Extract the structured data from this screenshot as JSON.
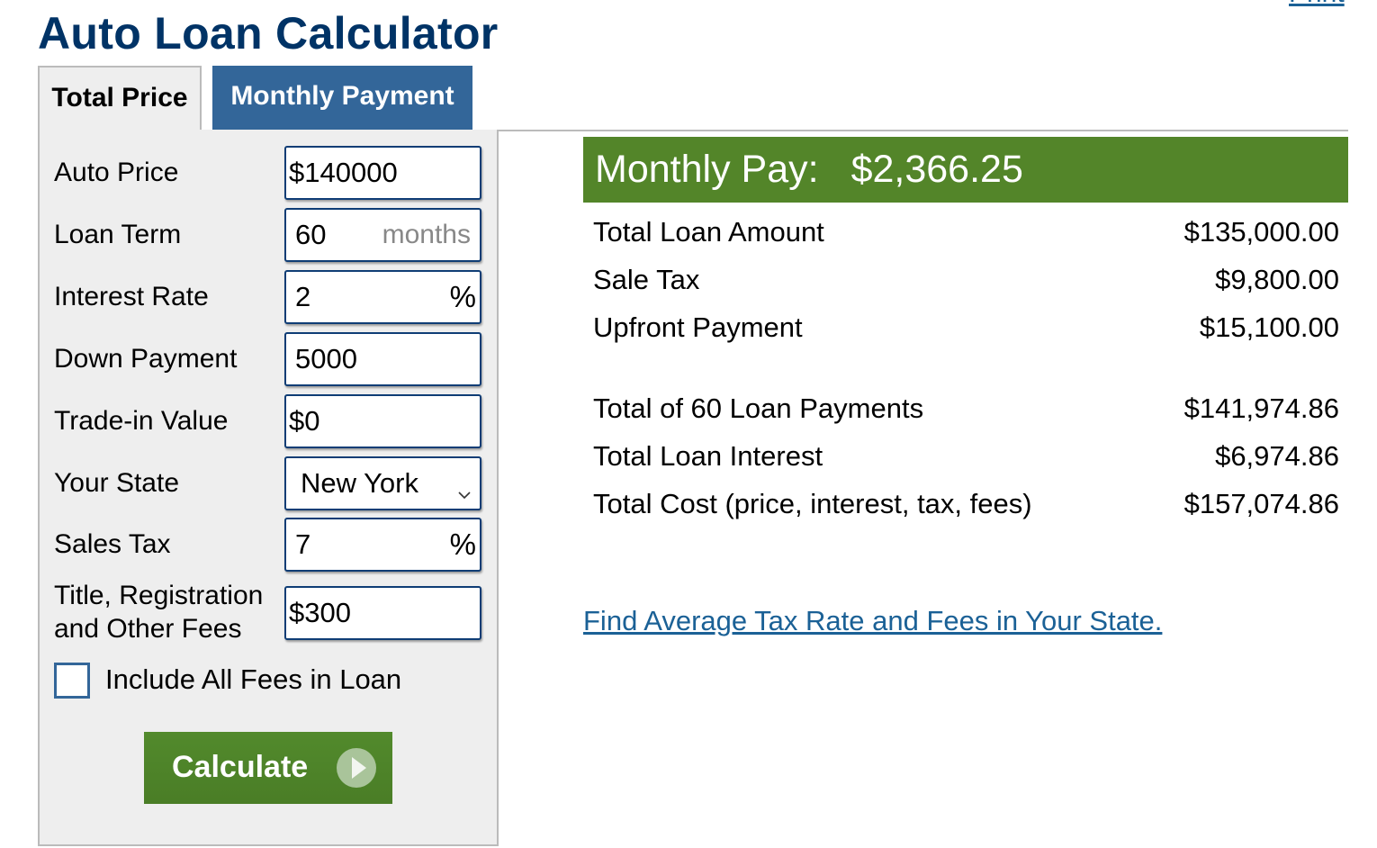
{
  "header": {
    "title": "Auto Loan Calculator",
    "print_link": "Print"
  },
  "tabs": [
    {
      "label": "Total Price",
      "active": true
    },
    {
      "label": "Monthly Payment",
      "active": false
    }
  ],
  "form": {
    "auto_price": {
      "label": "Auto Price",
      "value": "$140000"
    },
    "loan_term": {
      "label": "Loan Term",
      "value": "60",
      "unit": "months"
    },
    "interest_rate": {
      "label": "Interest Rate",
      "value": "2",
      "unit": "%"
    },
    "down_payment": {
      "label": "Down Payment",
      "value": "5000"
    },
    "trade_in": {
      "label": "Trade-in Value",
      "value": "$0"
    },
    "state": {
      "label": "Your State",
      "value": "New York"
    },
    "sales_tax": {
      "label": "Sales Tax",
      "value": "7",
      "unit": "%"
    },
    "fees": {
      "label_line1": "Title, Registration",
      "label_line2": "and Other Fees",
      "value": "$300"
    },
    "include_fees": {
      "label": "Include All Fees in Loan",
      "checked": false
    },
    "calculate_label": "Calculate"
  },
  "results": {
    "monthly_label": "Monthly Pay:",
    "monthly_value": "$2,366.25",
    "rows": [
      {
        "label": "Total Loan Amount",
        "value": "$135,000.00"
      },
      {
        "label": "Sale Tax",
        "value": "$9,800.00"
      },
      {
        "label": "Upfront Payment",
        "value": "$15,100.00"
      },
      {
        "label": "Total of 60 Loan Payments",
        "value": "$141,974.86"
      },
      {
        "label": "Total Loan Interest",
        "value": "$6,974.86"
      },
      {
        "label": "Total Cost (price, interest, tax, fees)",
        "value": "$157,074.86"
      }
    ],
    "find_link": "Find Average Tax Rate and Fees in Your State."
  },
  "colors": {
    "title": "#003366",
    "tab_active_bg": "#eeeeee",
    "tab_inactive_bg": "#336699",
    "result_header_bg": "#538529",
    "button_bg": "#4f8429",
    "link": "#1b6196"
  }
}
